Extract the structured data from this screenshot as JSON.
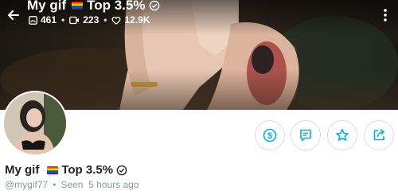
{
  "header": {
    "title": "My gif",
    "badge": "Top 3.5%",
    "stats": {
      "photos": "461",
      "videos": "223",
      "likes": "12.9K"
    }
  },
  "profile": {
    "display_name": "My gif",
    "badge": "Top 3.5%",
    "username": "@mygif77",
    "last_seen": "Seen  5 hours ago"
  },
  "icons": {
    "back": "arrow-left-icon",
    "more": "more-vertical-icon",
    "photos": "image-icon",
    "videos": "video-icon",
    "likes": "heart-icon",
    "verified": "verified-check-icon",
    "tip": "dollar-icon",
    "message": "message-icon",
    "favorite": "star-icon",
    "share": "share-icon"
  },
  "colors": {
    "accent": "#00aff0",
    "text": "#222222",
    "muted": "#8a96a3",
    "border": "#d7dde6"
  }
}
